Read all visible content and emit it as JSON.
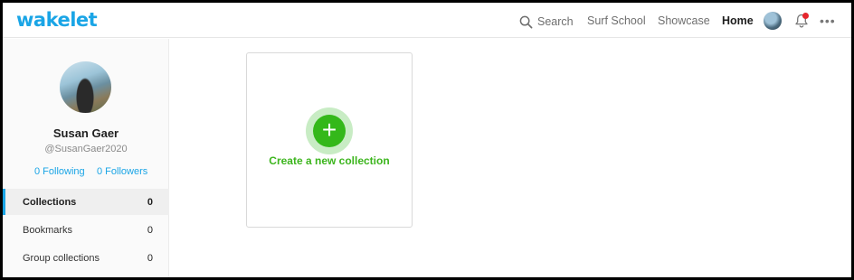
{
  "header": {
    "logo": "wakelet",
    "search_label": "Search",
    "nav": [
      "Surf School",
      "Showcase",
      "Home"
    ],
    "active_nav": "Home",
    "more_label": "•••"
  },
  "colors": {
    "brand": "#1aa5e6",
    "create_green": "#34b81a",
    "notification_dot": "#e6252c"
  },
  "profile": {
    "name": "Susan Gaer",
    "handle": "@SusanGaer2020",
    "following": "0 Following",
    "followers": "0 Followers"
  },
  "sidebar": {
    "items": [
      {
        "label": "Collections",
        "count": "0",
        "active": true
      },
      {
        "label": "Bookmarks",
        "count": "0",
        "active": false
      },
      {
        "label": "Group collections",
        "count": "0",
        "active": false
      }
    ]
  },
  "main": {
    "create_label": "Create a new collection",
    "create_icon": "+"
  }
}
